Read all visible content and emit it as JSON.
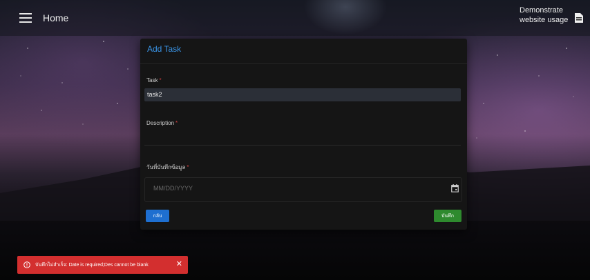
{
  "topbar": {
    "title": "Home",
    "user_line1": "Demonstrate",
    "user_line2": "website usage"
  },
  "dialog": {
    "title": "Add Task",
    "task_label": "Task",
    "task_value": "task2",
    "description_label": "Description",
    "date_label": "วันที่บันทึกข้อมูล",
    "date_placeholder": "MM/DD/YYYY",
    "required_mark": "*",
    "back_label": "กลับ",
    "save_label": "บันทึก"
  },
  "snackbar": {
    "message": "บันทึกไม่สำเร็จ: Date is required;Des cannot be blank",
    "close_label": "✕"
  },
  "colors": {
    "accent": "#3a95e8",
    "back_button": "#1e6fd0",
    "save_button": "#2e8a2e",
    "error": "#d32f2f"
  }
}
